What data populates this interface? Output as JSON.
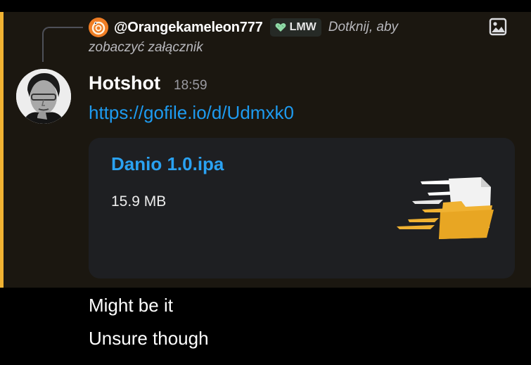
{
  "reply": {
    "author": "@Orangekameleon777",
    "tag": "LMW",
    "snippet_line1": "Dotknij, aby",
    "snippet_line2": "zobaczyć załącznik",
    "attachment_icon": "image-icon"
  },
  "message": {
    "author": "Hotshot",
    "time": "18:59",
    "link": "https://gofile.io/d/Udmxk0",
    "attachment": {
      "filename": "Danio 1.0.ipa",
      "size": "15.9 MB",
      "icon": "fast-folder-icon"
    }
  },
  "followups": [
    "Might be it",
    "Unsure though"
  ],
  "colors": {
    "accent": "#f0b232",
    "link": "#1e9bf0",
    "card": "#1e1f22",
    "highlight": "#1b1710"
  }
}
